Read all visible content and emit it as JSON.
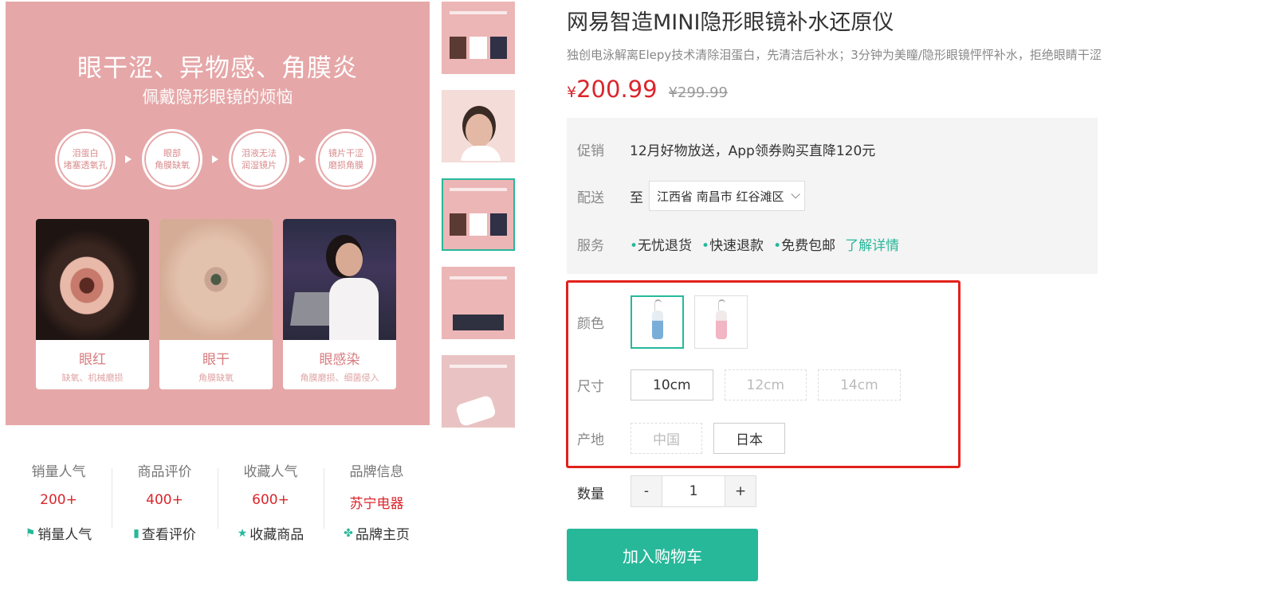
{
  "gallery": {
    "main": {
      "headline": "眼干涩、异物感、角膜炎",
      "subheadline": "佩戴隐形眼镜的烦恼",
      "causes": [
        {
          "line1": "泪蛋白",
          "line2": "堵塞透氧孔"
        },
        {
          "line1": "眼部",
          "line2": "角膜缺氧"
        },
        {
          "line1": "泪液无法",
          "line2": "润湿镜片"
        },
        {
          "line1": "镜片干涩",
          "line2": "磨损角膜"
        }
      ],
      "symptoms": [
        {
          "title": "眼红",
          "desc": "缺氧、机械磨损"
        },
        {
          "title": "眼干",
          "desc": "角膜缺氧"
        },
        {
          "title": "眼感染",
          "desc": "角膜磨损、细菌侵入"
        }
      ]
    },
    "active_thumb_index": 2
  },
  "stats": [
    {
      "label": "销量人气",
      "value": "200+",
      "action": "销量人气",
      "icon": "flag-icon",
      "glyph": "⚑"
    },
    {
      "label": "商品评价",
      "value": "400+",
      "action": "查看评价",
      "icon": "comment-icon",
      "glyph": "▮"
    },
    {
      "label": "收藏人气",
      "value": "600+",
      "action": "收藏商品",
      "icon": "star-icon",
      "glyph": "★"
    },
    {
      "label": "品牌信息",
      "value": "苏宁电器",
      "action": "品牌主页",
      "icon": "brand-icon",
      "glyph": "✤"
    }
  ],
  "product": {
    "title": "网易智造MINI隐形眼镜补水还原仪",
    "subtitle": "独创电泳解离Elepy技术清除泪蛋白，先清洁后补水；3分钟为美瞳/隐形眼镜怦怦补水，拒绝眼睛干涩",
    "price_currency": "¥",
    "price": "200.99",
    "original_price": "¥299.99"
  },
  "info": {
    "promo_label": "促销",
    "promo_text": "12月好物放送，App领券购买直降120元",
    "delivery_label": "配送",
    "delivery_prefix": "至",
    "delivery_region": "江西省 南昌市 红谷滩区",
    "service_label": "服务",
    "services": [
      "无忧退货",
      "快速退款",
      "免费包邮"
    ],
    "service_link": "了解详情"
  },
  "sku": {
    "color_label": "颜色",
    "colors": [
      "blue",
      "pink"
    ],
    "size_label": "尺寸",
    "sizes": [
      "10cm",
      "12cm",
      "14cm"
    ],
    "origin_label": "产地",
    "origins": [
      "中国",
      "日本"
    ]
  },
  "quantity": {
    "label": "数量",
    "minus": "-",
    "value": "1",
    "plus": "+"
  },
  "cart_button": "加入购物车",
  "colors": {
    "accent": "#27b89a",
    "price": "#d9262c",
    "highlight_border": "#e3211b",
    "banner_pink": "#e6a7a8"
  }
}
